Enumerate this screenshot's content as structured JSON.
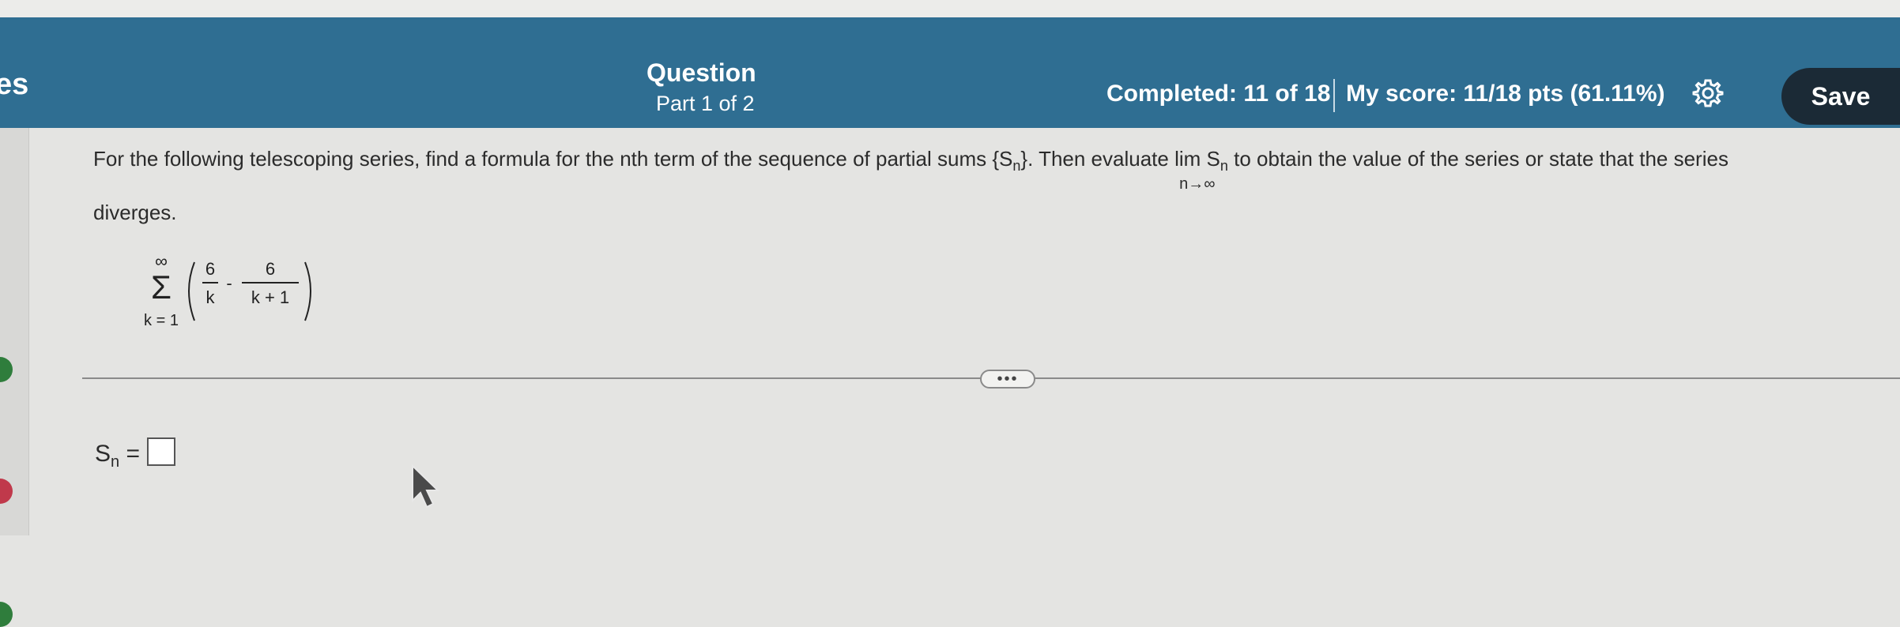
{
  "header": {
    "left_partial_text": "es",
    "title": "Question",
    "part": "Part 1 of 2",
    "completed": "Completed: 11 of 18",
    "score": "My score: 11/18 pts (61.11%)",
    "save_label": "Save"
  },
  "colors": {
    "header_bg": "#2f6e92",
    "save_bg": "#1b2a36",
    "correct": "#2f7d3c",
    "incorrect": "#c0394b"
  },
  "question": {
    "text_part1": "For the following telescoping series, find a formula for the nth term of the sequence of partial sums {S",
    "text_sub_n": "n",
    "text_part2": "}. Then evaluate ",
    "lim_word": "lim",
    "lim_S": "S",
    "lim_S_sub": "n",
    "lim_under": "n→∞",
    "text_part3": " to obtain the value of the series or state that the series",
    "text_line2": "diverges.",
    "series": {
      "upper": "∞",
      "sigma": "Σ",
      "lower": "k = 1",
      "num1": "6",
      "den1": "k",
      "minus": "-",
      "num2": "6",
      "den2": "k + 1"
    }
  },
  "more_label": "•••",
  "answer": {
    "label": "S",
    "label_sub": "n",
    "equals": "="
  }
}
